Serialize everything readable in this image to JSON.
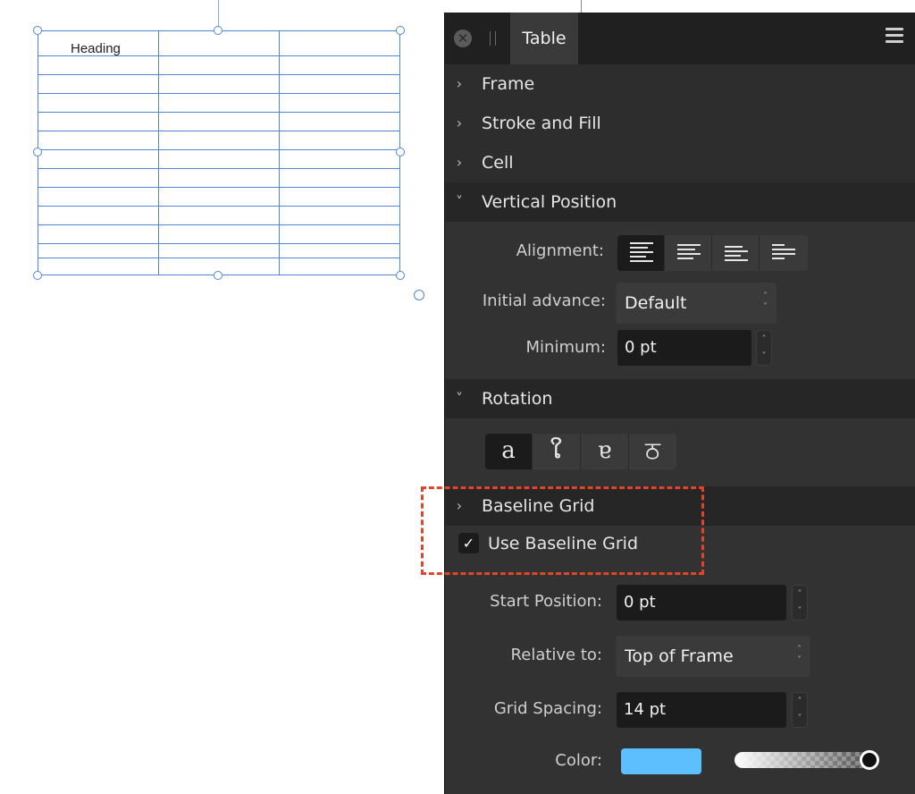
{
  "canvas": {
    "table_heading": "Heading"
  },
  "panel": {
    "tab": "Table",
    "close_glyph": "✕",
    "sections": {
      "frame": "Frame",
      "stroke_fill": "Stroke and Fill",
      "cell": "Cell",
      "vertical_position": "Vertical Position",
      "rotation": "Rotation",
      "baseline_grid": "Baseline Grid"
    },
    "vertical_position": {
      "alignment_label": "Alignment:",
      "initial_advance_label": "Initial advance:",
      "initial_advance_value": "Default",
      "minimum_label": "Minimum:",
      "minimum_value": "0 pt"
    },
    "rotation": {
      "glyphs": [
        "a",
        "ໃ",
        "ɐ",
        "ਠ"
      ]
    },
    "baseline_grid": {
      "use_label": "Use Baseline Grid",
      "checked_glyph": "✓",
      "start_position_label": "Start Position:",
      "start_position_value": "0 pt",
      "relative_to_label": "Relative to:",
      "relative_to_value": "Top of Frame",
      "grid_spacing_label": "Grid Spacing:",
      "grid_spacing_value": "14 pt",
      "color_label": "Color:",
      "color_hex": "#5ebfff"
    },
    "icons": {
      "chevron_right": "›",
      "chevron_down": "˅",
      "stepper_up": "˄",
      "stepper_down": "˅"
    }
  }
}
